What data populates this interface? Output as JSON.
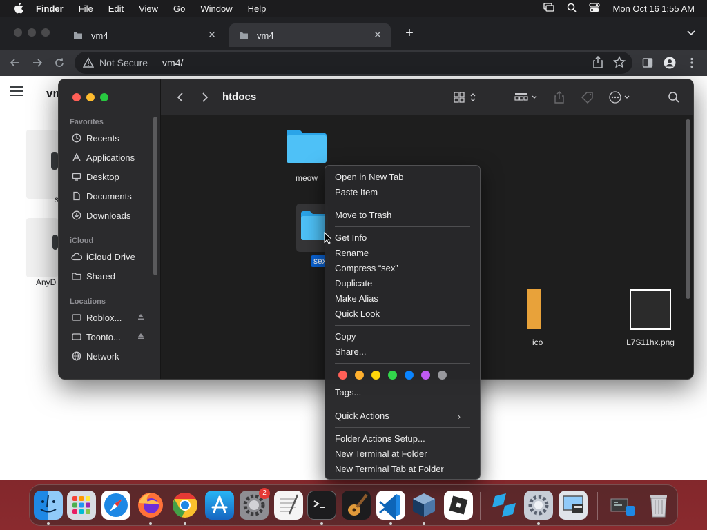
{
  "menubar": {
    "app_name": "Finder",
    "items": [
      "File",
      "Edit",
      "View",
      "Go",
      "Window",
      "Help"
    ],
    "clock": "Mon Oct 16  1:55 AM"
  },
  "browser": {
    "tabs": [
      {
        "label": "vm4",
        "active": false
      },
      {
        "label": "vm4",
        "active": true
      }
    ],
    "omnibox": {
      "security_label": "Not Secure",
      "url": "vm4/"
    },
    "page": {
      "title": "vm",
      "labels": [
        "s",
        "AnyD"
      ]
    }
  },
  "finder": {
    "title": "htdocs",
    "sidebar": {
      "favorites_header": "Favorites",
      "favorites": [
        "Recents",
        "Applications",
        "Desktop",
        "Documents",
        "Downloads"
      ],
      "icloud_header": "iCloud",
      "icloud": [
        "iCloud Drive",
        "Shared"
      ],
      "locations_header": "Locations",
      "locations": [
        "Roblox...",
        "Toonto...",
        "Network"
      ]
    },
    "items": {
      "meow": "meow",
      "sex": "sex",
      "ico": "ico",
      "png": "L7S11hx.png"
    }
  },
  "context_menu": {
    "group1": [
      "Open in New Tab",
      "Paste Item"
    ],
    "group2": [
      "Move to Trash"
    ],
    "group3": [
      "Get Info",
      "Rename",
      "Compress “sex”",
      "Duplicate",
      "Make Alias",
      "Quick Look"
    ],
    "group4": [
      "Copy",
      "Share..."
    ],
    "tag_colors": [
      "#ff5f57",
      "#ffb02e",
      "#ffd60a",
      "#32d74b",
      "#0a84ff",
      "#bf5af2",
      "#98989d"
    ],
    "tags_label": "Tags...",
    "quick_actions": "Quick Actions",
    "group6": [
      "Folder Actions Setup...",
      "New Terminal at Folder",
      "New Terminal Tab at Folder"
    ]
  },
  "dock": {
    "settings_badge": "2"
  },
  "colors": {
    "accent": "#0a84ff",
    "folder": "#4ec1f7"
  }
}
